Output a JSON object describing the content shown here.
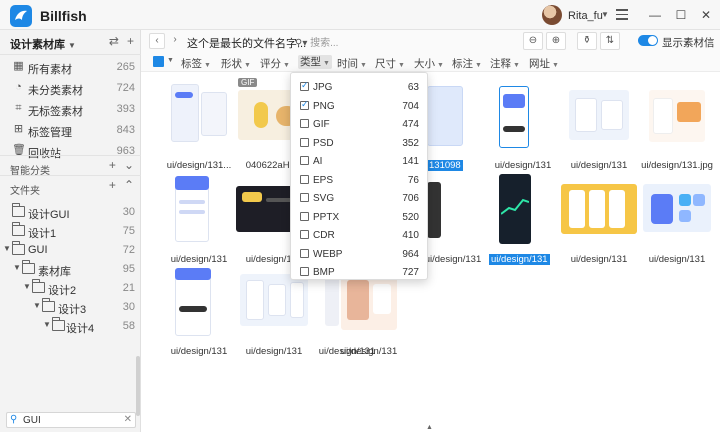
{
  "app": {
    "name": "Billfish",
    "user": "Rita_fu"
  },
  "window_controls": {
    "minimize": "—",
    "maximize": "☐",
    "close": "✕"
  },
  "sidebar": {
    "library": "设计素材库",
    "nav": [
      {
        "label": "所有素材",
        "count": "265",
        "icon": "grid-icon"
      },
      {
        "label": "未分类素材",
        "count": "724",
        "icon": "pie-icon"
      },
      {
        "label": "无标签素材",
        "count": "393",
        "icon": "tag-icon"
      },
      {
        "label": "标签管理",
        "count": "843",
        "icon": "tag-manage-icon"
      },
      {
        "label": "回收站",
        "count": "963",
        "icon": "trash-icon"
      }
    ],
    "smart_section": "智能分类",
    "folder_section": "文件夹",
    "folders": [
      {
        "label": "设计GUI",
        "count": "30"
      },
      {
        "label": "设计1",
        "count": "75"
      },
      {
        "label": "GUI",
        "count": "72"
      },
      {
        "label": "素材库",
        "count": "95"
      },
      {
        "label": "设计2",
        "count": "21"
      },
      {
        "label": "设计3",
        "count": "30"
      },
      {
        "label": "设计4",
        "count": "58"
      }
    ],
    "search_value": "GUI"
  },
  "toolbar": {
    "path": "这个是最长的文件名字...",
    "search_placeholder": "搜索...",
    "toggle_label": "显示素材信息"
  },
  "filters": [
    "标签",
    "形状",
    "评分",
    "类型",
    "时间",
    "尺寸",
    "大小",
    "标注",
    "注释",
    "网址"
  ],
  "type_dropdown": [
    {
      "label": "JPG",
      "count": "63",
      "checked": true
    },
    {
      "label": "PNG",
      "count": "704",
      "checked": true
    },
    {
      "label": "GIF",
      "count": "474",
      "checked": false
    },
    {
      "label": "PSD",
      "count": "352",
      "checked": false
    },
    {
      "label": "AI",
      "count": "141",
      "checked": false
    },
    {
      "label": "EPS",
      "count": "76",
      "checked": false
    },
    {
      "label": "SVG",
      "count": "706",
      "checked": false
    },
    {
      "label": "PPTX",
      "count": "520",
      "checked": false
    },
    {
      "label": "CDR",
      "count": "410",
      "checked": false
    },
    {
      "label": "WEBP",
      "count": "964",
      "checked": false
    },
    {
      "label": "BMP",
      "count": "727",
      "checked": false
    }
  ],
  "assets": [
    {
      "caption": "ui/design/131..."
    },
    {
      "caption": "040622aHc...",
      "badge": "GIF"
    },
    {
      "caption": "..."
    },
    {
      "caption": "131098"
    },
    {
      "caption": "ui/design/131"
    },
    {
      "caption": "ui/design/131"
    },
    {
      "caption": "ui/design/131.jpg"
    },
    {
      "caption": "ui/design/131"
    },
    {
      "caption": "ui/design/131"
    },
    {
      "caption": "ui/design/131"
    },
    {
      "caption": "ui/design/131"
    },
    {
      "caption": "ui/design/131"
    },
    {
      "caption": "ui/design/131"
    },
    {
      "caption": "ui/design/131"
    },
    {
      "caption": "ui/design/131"
    },
    {
      "caption": "ui/design/131"
    },
    {
      "caption": "ui/design/131"
    },
    {
      "caption": "ui/design/131"
    }
  ],
  "colors": {
    "accent": "#1e88e5"
  }
}
